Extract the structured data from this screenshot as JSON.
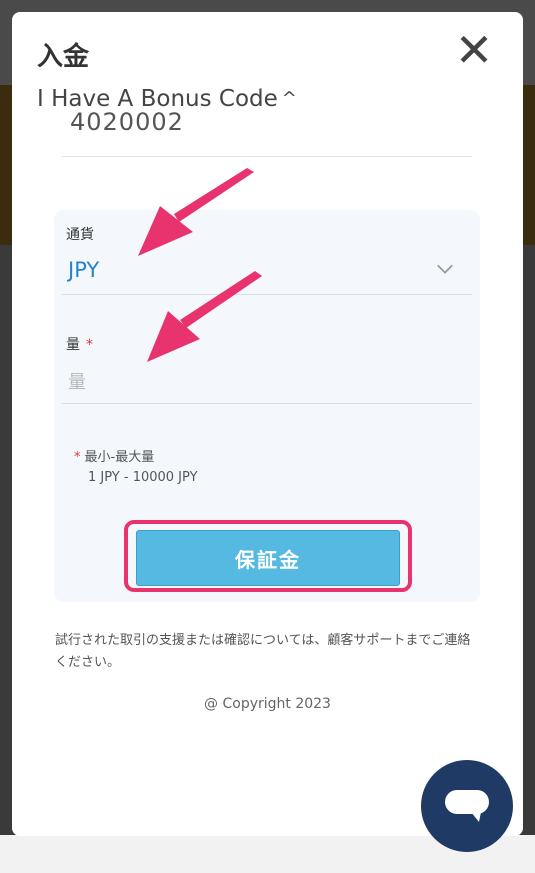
{
  "modal": {
    "title": "入金",
    "close_icon": "close-icon",
    "bonus_toggle_label": "I Have A Bonus Code",
    "bonus_toggle_icon": "chevron-up-icon"
  },
  "bonus_code": {
    "value": "4020002"
  },
  "form": {
    "currency": {
      "label": "通貨",
      "value": "JPY",
      "icon": "chevron-down-icon"
    },
    "amount": {
      "label": "量",
      "required_mark": "*",
      "placeholder": "量",
      "value": ""
    },
    "limits": {
      "required_mark": "*",
      "label": "最小-最大量",
      "range": "1 JPY - 10000 JPY"
    },
    "deposit_button": "保証金"
  },
  "footer": {
    "support_text": "試行された取引の支援または確認については、顧客サポートまでご連絡ください。",
    "copyright": "@ Copyright 2023"
  },
  "chat": {
    "icon": "chat-icon"
  },
  "colors": {
    "accent_blue": "#2583c8",
    "button_blue": "#55b9e2",
    "annotation_pink": "#e8336e",
    "required_red": "#e8323a",
    "chat_navy": "#1f3a64"
  }
}
